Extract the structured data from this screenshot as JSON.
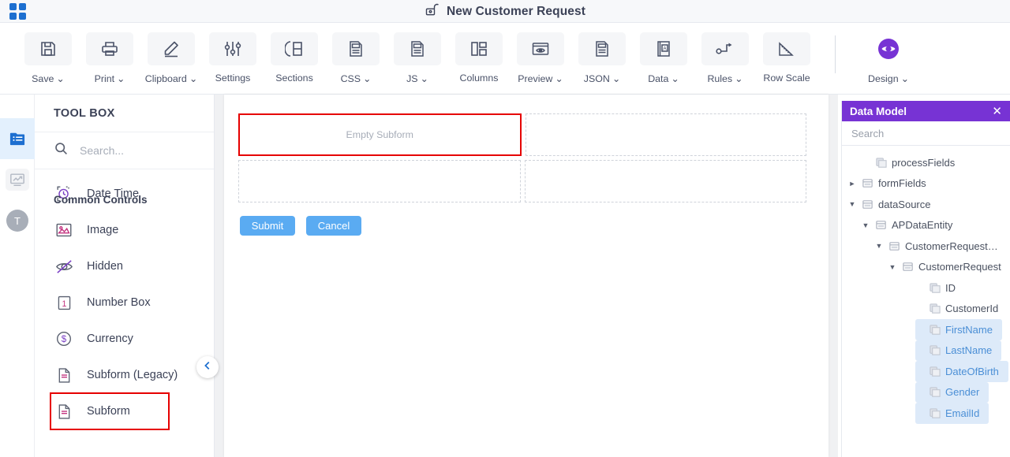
{
  "header": {
    "app_icon": "grid-apps-icon",
    "lock_icon": "unlocked-padlock-icon",
    "title": "New Customer Request"
  },
  "ribbon": {
    "items": [
      {
        "label": "Save",
        "icon": "save-floppy-icon",
        "caret": true
      },
      {
        "label": "Print",
        "icon": "printer-icon",
        "caret": true
      },
      {
        "label": "Clipboard",
        "icon": "pencil-edit-icon",
        "caret": true
      },
      {
        "label": "Settings",
        "icon": "sliders-icon",
        "caret": false
      },
      {
        "label": "Sections",
        "icon": "sections-split-icon",
        "caret": false
      },
      {
        "label": "CSS",
        "icon": "css-file-icon",
        "caret": true
      },
      {
        "label": "JS",
        "icon": "js-file-icon",
        "caret": true
      },
      {
        "label": "Columns",
        "icon": "columns-layout-icon",
        "caret": false
      },
      {
        "label": "Preview",
        "icon": "eye-preview-icon",
        "caret": true
      },
      {
        "label": "JSON",
        "icon": "json-file-icon",
        "caret": true
      },
      {
        "label": "Data",
        "icon": "data-book-icon",
        "caret": true
      },
      {
        "label": "Rules",
        "icon": "rules-flow-icon",
        "caret": true
      },
      {
        "label": "Row Scale",
        "icon": "ruler-icon",
        "caret": false
      }
    ],
    "design": {
      "label": "Design",
      "icon": "eye-design-icon",
      "caret": true,
      "color": "#7733d4"
    }
  },
  "rail": {
    "items": [
      {
        "name": "forms-list",
        "icon": "folder-list-icon",
        "active": true
      },
      {
        "name": "reports",
        "icon": "chart-monitor-icon",
        "active": false
      },
      {
        "name": "themes",
        "icon": "t-letter-icon",
        "active": false
      }
    ]
  },
  "toolbox": {
    "title": "TOOL BOX",
    "search_placeholder": "Search...",
    "search_value": "",
    "search_icon": "search-icon",
    "group_label": "Common Controls",
    "items": [
      {
        "label": "Date Time",
        "icon": "date-time-icon",
        "highlight": false
      },
      {
        "label": "Image",
        "icon": "image-icon",
        "highlight": false
      },
      {
        "label": "Hidden",
        "icon": "hidden-eye-icon",
        "highlight": false
      },
      {
        "label": "Number Box",
        "icon": "number-one-icon",
        "highlight": false
      },
      {
        "label": "Currency",
        "icon": "currency-dollar-icon",
        "highlight": false
      },
      {
        "label": "Subform (Legacy)",
        "icon": "document-lines-icon",
        "highlight": false
      },
      {
        "label": "Subform",
        "icon": "document-lines-icon",
        "highlight": true
      }
    ],
    "collapse_icon": "chevron-left-icon"
  },
  "canvas": {
    "cells": [
      {
        "text": "Empty Subform",
        "selected": true
      },
      {
        "text": "",
        "selected": false
      },
      {
        "text": "",
        "selected": false
      },
      {
        "text": "",
        "selected": false
      }
    ],
    "submit_label": "Submit",
    "cancel_label": "Cancel",
    "button_color": "#5aabf2"
  },
  "data_model": {
    "title": "Data Model",
    "header_color": "#7733d4",
    "close_icon": "close-icon",
    "search_placeholder": "Search",
    "search_value": "",
    "tree": [
      {
        "label": "processFields",
        "depth": 1,
        "twisty": "none",
        "icon": "leaf-field-icon",
        "selected": false
      },
      {
        "label": "formFields",
        "depth": 0,
        "twisty": "collapsed",
        "icon": "folder-table-icon",
        "selected": false
      },
      {
        "label": "dataSource",
        "depth": 0,
        "twisty": "expanded",
        "icon": "folder-table-icon",
        "selected": false
      },
      {
        "label": "APDataEntity",
        "depth": 1,
        "twisty": "expanded",
        "icon": "folder-table-icon",
        "selected": false
      },
      {
        "label": "CustomerRequest…",
        "depth": 2,
        "twisty": "expanded",
        "icon": "folder-table-icon",
        "selected": false
      },
      {
        "label": "CustomerRequest",
        "depth": 3,
        "twisty": "expanded",
        "icon": "folder-table-icon",
        "selected": false
      },
      {
        "label": "ID",
        "depth": 5,
        "twisty": "none",
        "icon": "leaf-field-icon",
        "selected": false
      },
      {
        "label": "CustomerId",
        "depth": 5,
        "twisty": "none",
        "icon": "leaf-field-icon",
        "selected": false
      },
      {
        "label": "FirstName",
        "depth": 5,
        "twisty": "none",
        "icon": "leaf-field-icon",
        "selected": true
      },
      {
        "label": "LastName",
        "depth": 5,
        "twisty": "none",
        "icon": "leaf-field-icon",
        "selected": true
      },
      {
        "label": "DateOfBirth",
        "depth": 5,
        "twisty": "none",
        "icon": "leaf-field-icon",
        "selected": true
      },
      {
        "label": "Gender",
        "depth": 5,
        "twisty": "none",
        "icon": "leaf-field-icon",
        "selected": true
      },
      {
        "label": "EmailId",
        "depth": 5,
        "twisty": "none",
        "icon": "leaf-field-icon",
        "selected": true
      }
    ]
  }
}
